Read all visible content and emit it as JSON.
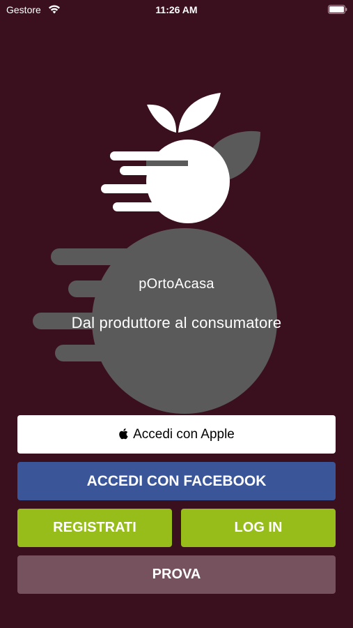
{
  "status_bar": {
    "carrier": "Gestore",
    "time": "11:26 AM",
    "wifi_icon": "wifi-icon",
    "battery_icon": "battery-icon"
  },
  "branding": {
    "app_name": "pOrtoAcasa",
    "tagline": "Dal produttore al consumatore",
    "logo_icon": "fruit-logo-icon"
  },
  "buttons": {
    "apple_label": "Accedi con Apple",
    "facebook_label": "ACCEDI CON FACEBOOK",
    "register_label": "REGISTRATI",
    "login_label": "LOG IN",
    "try_label": "PROVA"
  },
  "colors": {
    "background": "#3a0f1e",
    "facebook": "#3b5698",
    "green": "#97bd1b",
    "prova": "#75525d",
    "logo_gray": "#5a5a5a"
  }
}
